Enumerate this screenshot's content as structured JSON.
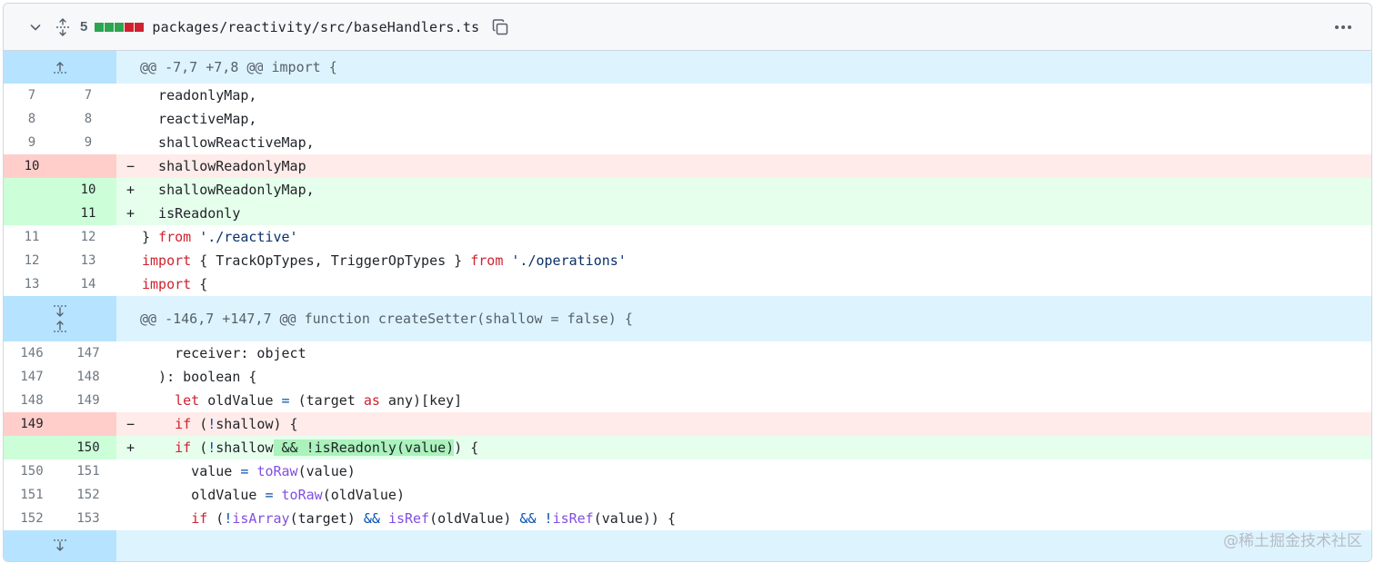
{
  "header": {
    "changes_count": "5",
    "file_path": "packages/reactivity/src/baseHandlers.ts",
    "diffstat_colors": [
      "#2da44e",
      "#2da44e",
      "#2da44e",
      "#cf222e",
      "#cf222e"
    ]
  },
  "hunks": [
    {
      "header": "@@ -7,7 +7,8 @@ import {"
    },
    {
      "header": "@@ -146,7 +147,7 @@ function createSetter(shallow = false) {"
    }
  ],
  "lines": [
    {
      "old": "7",
      "new": "7"
    },
    {
      "old": "8",
      "new": "8"
    },
    {
      "old": "9",
      "new": "9"
    },
    {
      "old": "10",
      "new": ""
    },
    {
      "old": "",
      "new": "10"
    },
    {
      "old": "",
      "new": "11"
    },
    {
      "old": "11",
      "new": "12"
    },
    {
      "old": "12",
      "new": "13"
    },
    {
      "old": "13",
      "new": "14"
    },
    {
      "old": "146",
      "new": "147"
    },
    {
      "old": "147",
      "new": "148"
    },
    {
      "old": "148",
      "new": "149"
    },
    {
      "old": "149",
      "new": ""
    },
    {
      "old": "",
      "new": "150"
    },
    {
      "old": "150",
      "new": "151"
    },
    {
      "old": "151",
      "new": "152"
    },
    {
      "old": "152",
      "new": "153"
    }
  ],
  "code": {
    "l0": "  readonlyMap,",
    "l1": "  reactiveMap,",
    "l2": "  shallowReactiveMap,",
    "l3": "  shallowReadonlyMap",
    "l4": "  shallowReadonlyMap,",
    "l5": "  isReadonly",
    "l6_a": "} ",
    "l6_kw": "from",
    "l6_sp": " ",
    "l6_str": "'./reactive'",
    "l7_kw": "import",
    "l7_mid": " { TrackOpTypes, TriggerOpTypes } ",
    "l7_kw2": "from",
    "l7_sp": " ",
    "l7_str": "'./operations'",
    "l8_kw": "import",
    "l8_rest": " {",
    "l9": "    receiver: object",
    "l10": "  ): boolean {",
    "l11_ind": "    ",
    "l11_kw": "let",
    "l11_a": " oldValue ",
    "l11_op": "=",
    "l11_b": " (target ",
    "l11_kw2": "as",
    "l11_c": " any)[key]",
    "l12_ind": "    ",
    "l12_kw": "if",
    "l12_a": " (",
    "l12_op": "!",
    "l12_b": "shallow) {",
    "l13_ind": "    ",
    "l13_kw": "if",
    "l13_a": " (",
    "l13_op": "!",
    "l13_b": "shallow",
    "l13_hl": " && !isReadonly(value)",
    "l13_c": ") {",
    "l14_a": "      value ",
    "l14_op": "=",
    "l14_sp": " ",
    "l14_fn": "toRaw",
    "l14_b": "(value)",
    "l15_a": "      oldValue ",
    "l15_op": "=",
    "l15_sp": " ",
    "l15_fn": "toRaw",
    "l15_b": "(oldValue)",
    "l16_ind": "      ",
    "l16_kw": "if",
    "l16_a": " (",
    "l16_op": "!",
    "l16_fn": "isArray",
    "l16_b": "(target) ",
    "l16_op2": "&&",
    "l16_sp": " ",
    "l16_fn2": "isRef",
    "l16_c": "(oldValue) ",
    "l16_op3": "&&",
    "l16_sp2": " ",
    "l16_op4": "!",
    "l16_fn3": "isRef",
    "l16_d": "(value)) {"
  },
  "signs": {
    "del": "−",
    "add": "+"
  },
  "watermark": "@稀土掘金技术社区"
}
